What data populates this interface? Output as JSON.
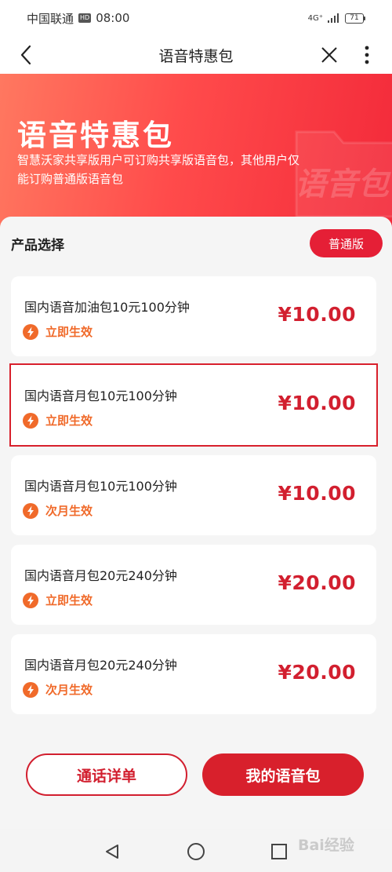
{
  "status_bar": {
    "carrier": "中国联通",
    "hd": "HD",
    "time": "08:00",
    "network": "4G⁺",
    "battery": "71"
  },
  "nav": {
    "title": "语音特惠包"
  },
  "hero": {
    "title": "语音特惠包",
    "description": "智慧沃家共享版用户可订购共享版语音包，其他用户仅能订购普通版语音包",
    "watermark_text": "语音包"
  },
  "section": {
    "title": "产品选择",
    "version_button": "普通版"
  },
  "products": [
    {
      "name": "国内语音加油包10元100分钟",
      "effect": "立即生效",
      "price": "¥10.00",
      "selected": false
    },
    {
      "name": "国内语音月包10元100分钟",
      "effect": "立即生效",
      "price": "¥10.00",
      "selected": true
    },
    {
      "name": "国内语音月包10元100分钟",
      "effect": "次月生效",
      "price": "¥10.00",
      "selected": false
    },
    {
      "name": "国内语音月包20元240分钟",
      "effect": "立即生效",
      "price": "¥20.00",
      "selected": false
    },
    {
      "name": "国内语音月包20元240分钟",
      "effect": "次月生效",
      "price": "¥20.00",
      "selected": false
    }
  ],
  "actions": {
    "detail": "通话详单",
    "mine": "我的语音包"
  },
  "watermark": "Bai经验",
  "colors": {
    "accent": "#d8202c",
    "effect": "#f06a2a"
  },
  "icons": {
    "back": "back-arrow-icon",
    "close": "close-icon",
    "more": "more-vertical-icon",
    "effect": "lightning-icon",
    "sys_back": "triangle-back-icon",
    "sys_home": "circle-home-icon",
    "sys_recent": "square-recent-icon"
  }
}
